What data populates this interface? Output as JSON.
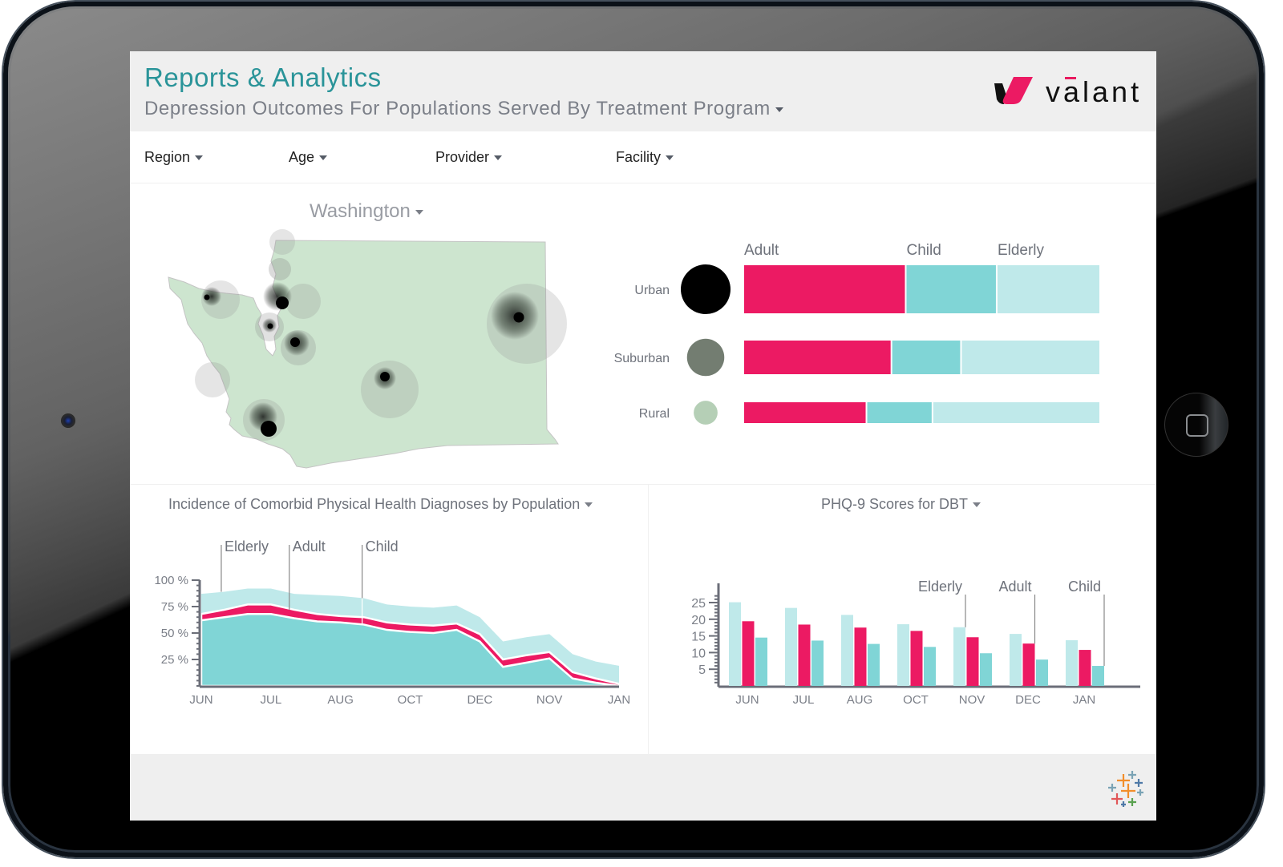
{
  "header": {
    "title": "Reports & Analytics",
    "subtitle": "Depression Outcomes For Populations Served By Treatment Program",
    "logo_text": "valant"
  },
  "filters": [
    {
      "label": "Region"
    },
    {
      "label": "Age"
    },
    {
      "label": "Provider"
    },
    {
      "label": "Facility"
    }
  ],
  "map": {
    "title": "Washington",
    "icon": "map-of-washington"
  },
  "colors": {
    "adult": "#ec1a63",
    "child": "#80d5d6",
    "elderly": "#bfe9ea",
    "urban": "#000000",
    "suburban": "#737d71",
    "rural": "#b5cfb6",
    "map_fill": "#cde5cf",
    "title_teal": "#2a9499"
  },
  "chart_data": [
    {
      "type": "bar",
      "stacked": true,
      "orientation": "horizontal",
      "title": "",
      "categories": [
        "Urban",
        "Suburban",
        "Rural"
      ],
      "series": [
        {
          "name": "Adult",
          "values": [
            45.5,
            41.5,
            34.5
          ]
        },
        {
          "name": "Child",
          "values": [
            25.5,
            19.5,
            18.5
          ]
        },
        {
          "name": "Elderly",
          "values": [
            29.0,
            39.0,
            47.0
          ]
        }
      ],
      "bubble_size": {
        "Urban": 1.0,
        "Suburban": 0.75,
        "Rural": 0.48
      },
      "xlabel": "",
      "ylabel": "",
      "xlim": [
        0,
        100
      ],
      "legend": "top"
    },
    {
      "type": "area",
      "stacked": true,
      "title": "Incidence of Comorbid Physical Health Diagnoses by Population",
      "x": [
        "JUN",
        "",
        "",
        "JUL",
        "",
        "",
        "AUG",
        "",
        "",
        "OCT",
        "",
        "",
        "DEC",
        "",
        "",
        "NOV",
        "",
        "",
        "JAN"
      ],
      "tick_labels": [
        "JUN",
        "JUL",
        "AUG",
        "OCT",
        "DEC",
        "NOV",
        "JAN"
      ],
      "series": [
        {
          "name": "Child",
          "values": [
            62,
            65,
            68,
            68,
            64,
            61,
            60,
            58,
            53,
            51,
            50,
            53,
            42,
            18,
            22,
            26,
            7,
            3,
            0
          ]
        },
        {
          "name": "Adult",
          "values": [
            6,
            7,
            9,
            9,
            8,
            7,
            6,
            7,
            7,
            7,
            7,
            6,
            7,
            7,
            7,
            6,
            6,
            4,
            2
          ]
        },
        {
          "name": "Elderly",
          "values": [
            19,
            17,
            15,
            15,
            15,
            18,
            19,
            18,
            17,
            17,
            17,
            17,
            16,
            17,
            17,
            17,
            17,
            16,
            17
          ]
        }
      ],
      "yticks": [
        "100 %",
        "75 %",
        "50 %",
        "25 %"
      ],
      "ylim": [
        0,
        100
      ],
      "xlabel": "",
      "ylabel": "",
      "legend_annotations": [
        "Elderly",
        "Adult",
        "Child"
      ]
    },
    {
      "type": "bar",
      "title": "PHQ-9 Scores for DBT",
      "categories": [
        "JUN",
        "JUL",
        "AUG",
        "OCT",
        "NOV",
        "DEC",
        "JAN"
      ],
      "series": [
        {
          "name": "Elderly",
          "values": [
            25.1,
            23.4,
            21.3,
            18.5,
            17.6,
            15.6,
            13.7
          ]
        },
        {
          "name": "Adult",
          "values": [
            19.4,
            18.4,
            17.5,
            16.5,
            14.6,
            12.7,
            10.8
          ]
        },
        {
          "name": "Child",
          "values": [
            14.5,
            13.6,
            12.6,
            11.7,
            9.8,
            7.9,
            6.0
          ]
        }
      ],
      "yticks": [
        "25",
        "20",
        "15",
        "10",
        "5"
      ],
      "ylim": [
        0,
        27.5
      ],
      "xlabel": "",
      "ylabel": "",
      "legend_annotations": [
        "Elderly",
        "Adult",
        "Child"
      ]
    }
  ],
  "footer": {
    "logo": "tableau-logo"
  }
}
